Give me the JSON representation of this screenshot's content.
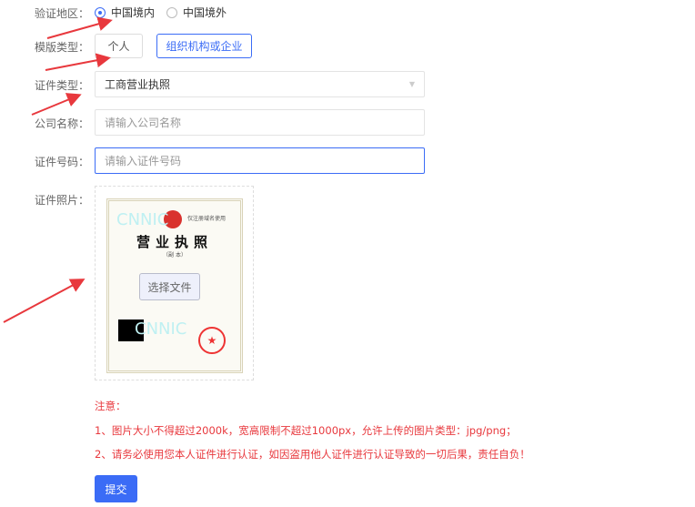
{
  "form": {
    "region": {
      "label": "验证地区：",
      "options": [
        "中国境内",
        "中国境外"
      ],
      "selected": "中国境内"
    },
    "template": {
      "label": "模版类型：",
      "options": [
        "个人",
        "组织机构或企业"
      ],
      "selected": "组织机构或企业"
    },
    "cert_type": {
      "label": "证件类型：",
      "value": "工商营业执照"
    },
    "company": {
      "label": "公司名称：",
      "placeholder": "请输入公司名称"
    },
    "cert_no": {
      "label": "证件号码：",
      "placeholder": "请输入证件号码"
    },
    "photo": {
      "label": "证件照片：",
      "choose_file": "选择文件",
      "sample": {
        "title": "营业执照",
        "subtitle": "（副 本）",
        "corner_note": "仅注册域名使用",
        "watermark": "CNNIC"
      }
    }
  },
  "notes": {
    "heading": "注意：",
    "items": [
      "1、图片大小不得超过2000k，宽高限制不超过1000px，允许上传的图片类型：jpg/png；",
      "2、请务必使用您本人证件进行认证，如因盗用他人证件进行认证导致的一切后果，责任自负！"
    ]
  },
  "submit_label": "提交",
  "colors": {
    "accent": "#3b6cf6",
    "warning": "#e8383d",
    "arrow": "#e8383d"
  }
}
